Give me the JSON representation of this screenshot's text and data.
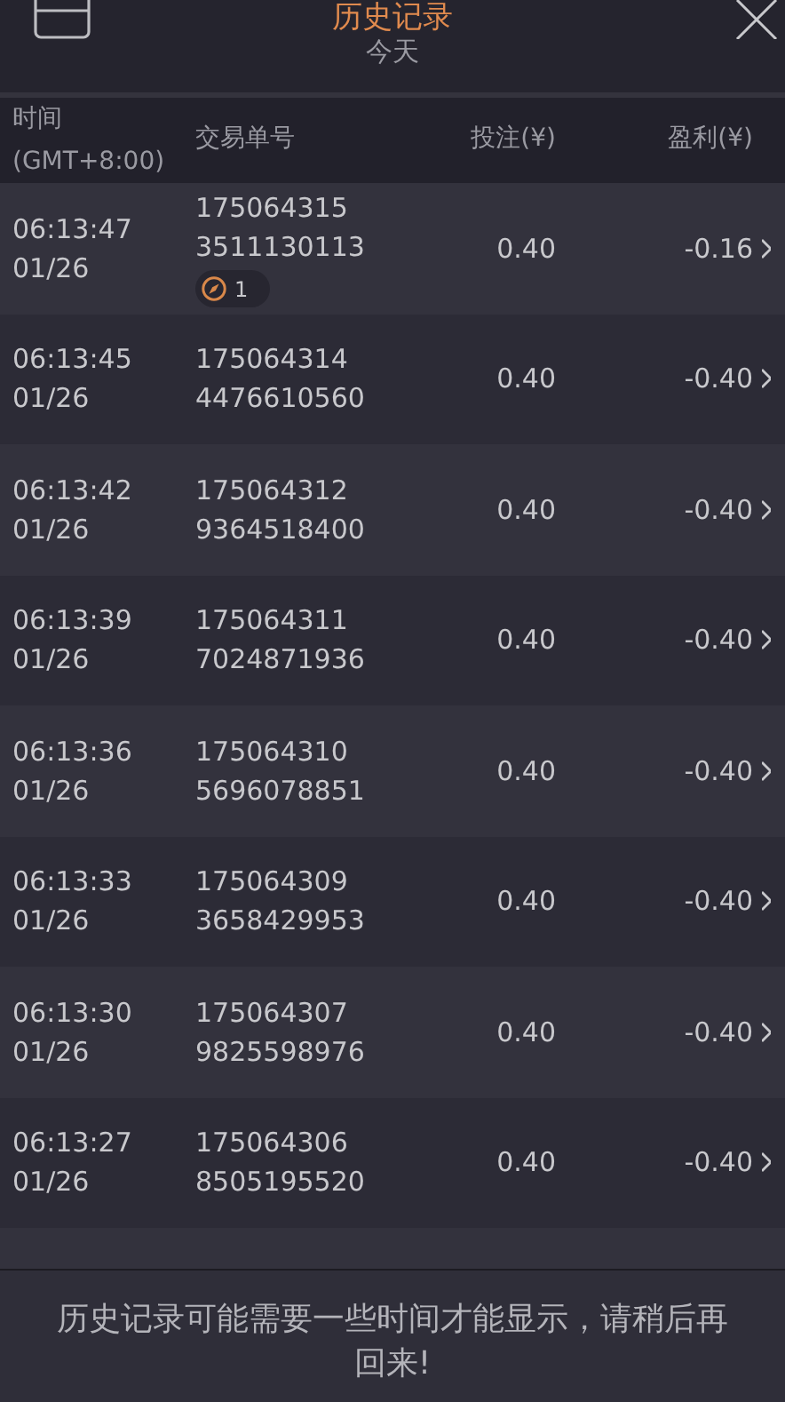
{
  "header": {
    "title": "历史记录",
    "subtitle": "今天"
  },
  "columns": [
    "时间",
    "(GMT+8:00)",
    "交易单号",
    "投注(¥)",
    "盈利(¥)"
  ],
  "rows": [
    {
      "time": "06:13:47",
      "date": "01/26",
      "order_no": [
        "175064315",
        "3511130113"
      ],
      "stake": "0.40",
      "profit": "-0.16",
      "badge": "1"
    },
    {
      "time": "06:13:45",
      "date": "01/26",
      "order_no": [
        "175064314",
        "4476610560"
      ],
      "stake": "0.40",
      "profit": "-0.40"
    },
    {
      "time": "06:13:42",
      "date": "01/26",
      "order_no": [
        "175064312",
        "9364518400"
      ],
      "stake": "0.40",
      "profit": "-0.40"
    },
    {
      "time": "06:13:39",
      "date": "01/26",
      "order_no": [
        "175064311",
        "7024871936"
      ],
      "stake": "0.40",
      "profit": "-0.40"
    },
    {
      "time": "06:13:36",
      "date": "01/26",
      "order_no": [
        "175064310",
        "5696078851"
      ],
      "stake": "0.40",
      "profit": "-0.40"
    },
    {
      "time": "06:13:33",
      "date": "01/26",
      "order_no": [
        "175064309",
        "3658429953"
      ],
      "stake": "0.40",
      "profit": "-0.40"
    },
    {
      "time": "06:13:30",
      "date": "01/26",
      "order_no": [
        "175064307",
        "9825598976"
      ],
      "stake": "0.40",
      "profit": "-0.40"
    },
    {
      "time": "06:13:27",
      "date": "01/26",
      "order_no": [
        "175064306",
        "8505195520"
      ],
      "stake": "0.40",
      "profit": "-0.40"
    }
  ],
  "notice": "历史记录可能需要一些时间才能显示，请稍后再回来!"
}
